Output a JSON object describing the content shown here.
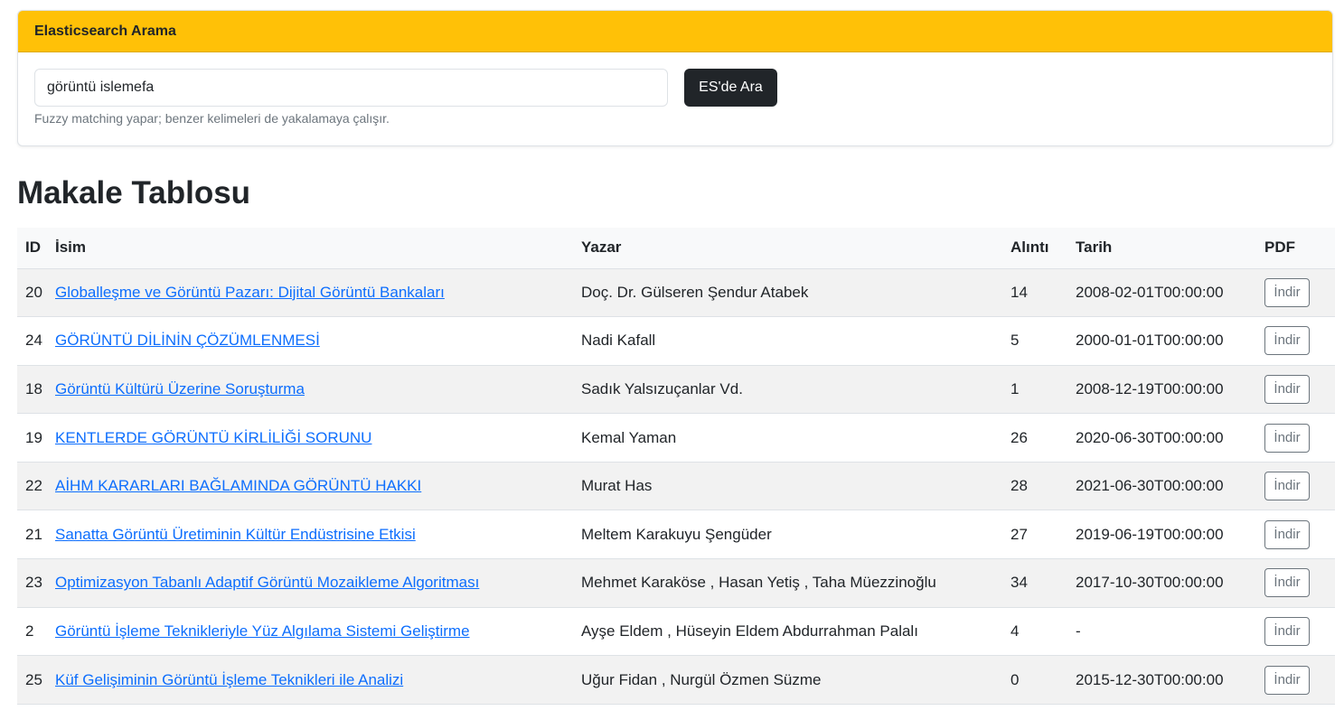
{
  "search_card": {
    "header": "Elasticsearch Arama",
    "input_value": "görüntü islemefa",
    "button_label": "ES'de Ara",
    "help_text": "Fuzzy matching yapar; benzer kelimeleri de yakalamaya çalışır."
  },
  "page_title": "Makale Tablosu",
  "table": {
    "headers": {
      "id": "ID",
      "name": "İsim",
      "author": "Yazar",
      "citations": "Alıntı",
      "date": "Tarih",
      "pdf": "PDF"
    },
    "rows": [
      {
        "id": "20",
        "name": "Globalleşme ve Görüntü Pazarı: Dijital Görüntü Bankaları",
        "author": "Doç. Dr. Gülseren Şendur Atabek",
        "citations": "14",
        "date": "2008-02-01T00:00:00",
        "pdf": "İndir"
      },
      {
        "id": "24",
        "name": "GÖRÜNTÜ DİLİNİN ÇÖZÜMLENMESİ",
        "author": "Nadi Kafall",
        "citations": "5",
        "date": "2000-01-01T00:00:00",
        "pdf": "İndir"
      },
      {
        "id": "18",
        "name": "Görüntü Kültürü Üzerine Soruşturma",
        "author": "Sadık Yalsızuçanlar Vd.",
        "citations": "1",
        "date": "2008-12-19T00:00:00",
        "pdf": "İndir"
      },
      {
        "id": "19",
        "name": "KENTLERDE GÖRÜNTÜ KİRLİLİĞİ SORUNU",
        "author": "Kemal Yaman",
        "citations": "26",
        "date": "2020-06-30T00:00:00",
        "pdf": "İndir"
      },
      {
        "id": "22",
        "name": "AİHM KARARLARI BAĞLAMINDA GÖRÜNTÜ HAKKI",
        "author": "Murat Has",
        "citations": "28",
        "date": "2021-06-30T00:00:00",
        "pdf": "İndir"
      },
      {
        "id": "21",
        "name": "Sanatta Görüntü Üretiminin Kültür Endüstrisine Etkisi",
        "author": "Meltem Karakuyu Şengüder",
        "citations": "27",
        "date": "2019-06-19T00:00:00",
        "pdf": "İndir"
      },
      {
        "id": "23",
        "name": "Optimizasyon Tabanlı Adaptif Görüntü Mozaikleme Algoritması",
        "author": "Mehmet Karaköse , Hasan Yetiş , Taha Müezzinoğlu",
        "citations": "34",
        "date": "2017-10-30T00:00:00",
        "pdf": "İndir"
      },
      {
        "id": "2",
        "name": "Görüntü İşleme Teknikleriyle Yüz Algılama Sistemi Geliştirme",
        "author": "Ayşe Eldem , Hüseyin Eldem Abdurrahman Palalı",
        "citations": "4",
        "date": "-",
        "pdf": "İndir"
      },
      {
        "id": "25",
        "name": "Küf Gelişiminin Görüntü İşleme Teknikleri ile Analizi",
        "author": "Uğur Fidan , Nurgül Özmen Süzme",
        "citations": "0",
        "date": "2015-12-30T00:00:00",
        "pdf": "İndir"
      }
    ]
  },
  "colors": {
    "header_accent": "#ffc107",
    "link": "#0d6efd",
    "button_dark": "#212529"
  }
}
